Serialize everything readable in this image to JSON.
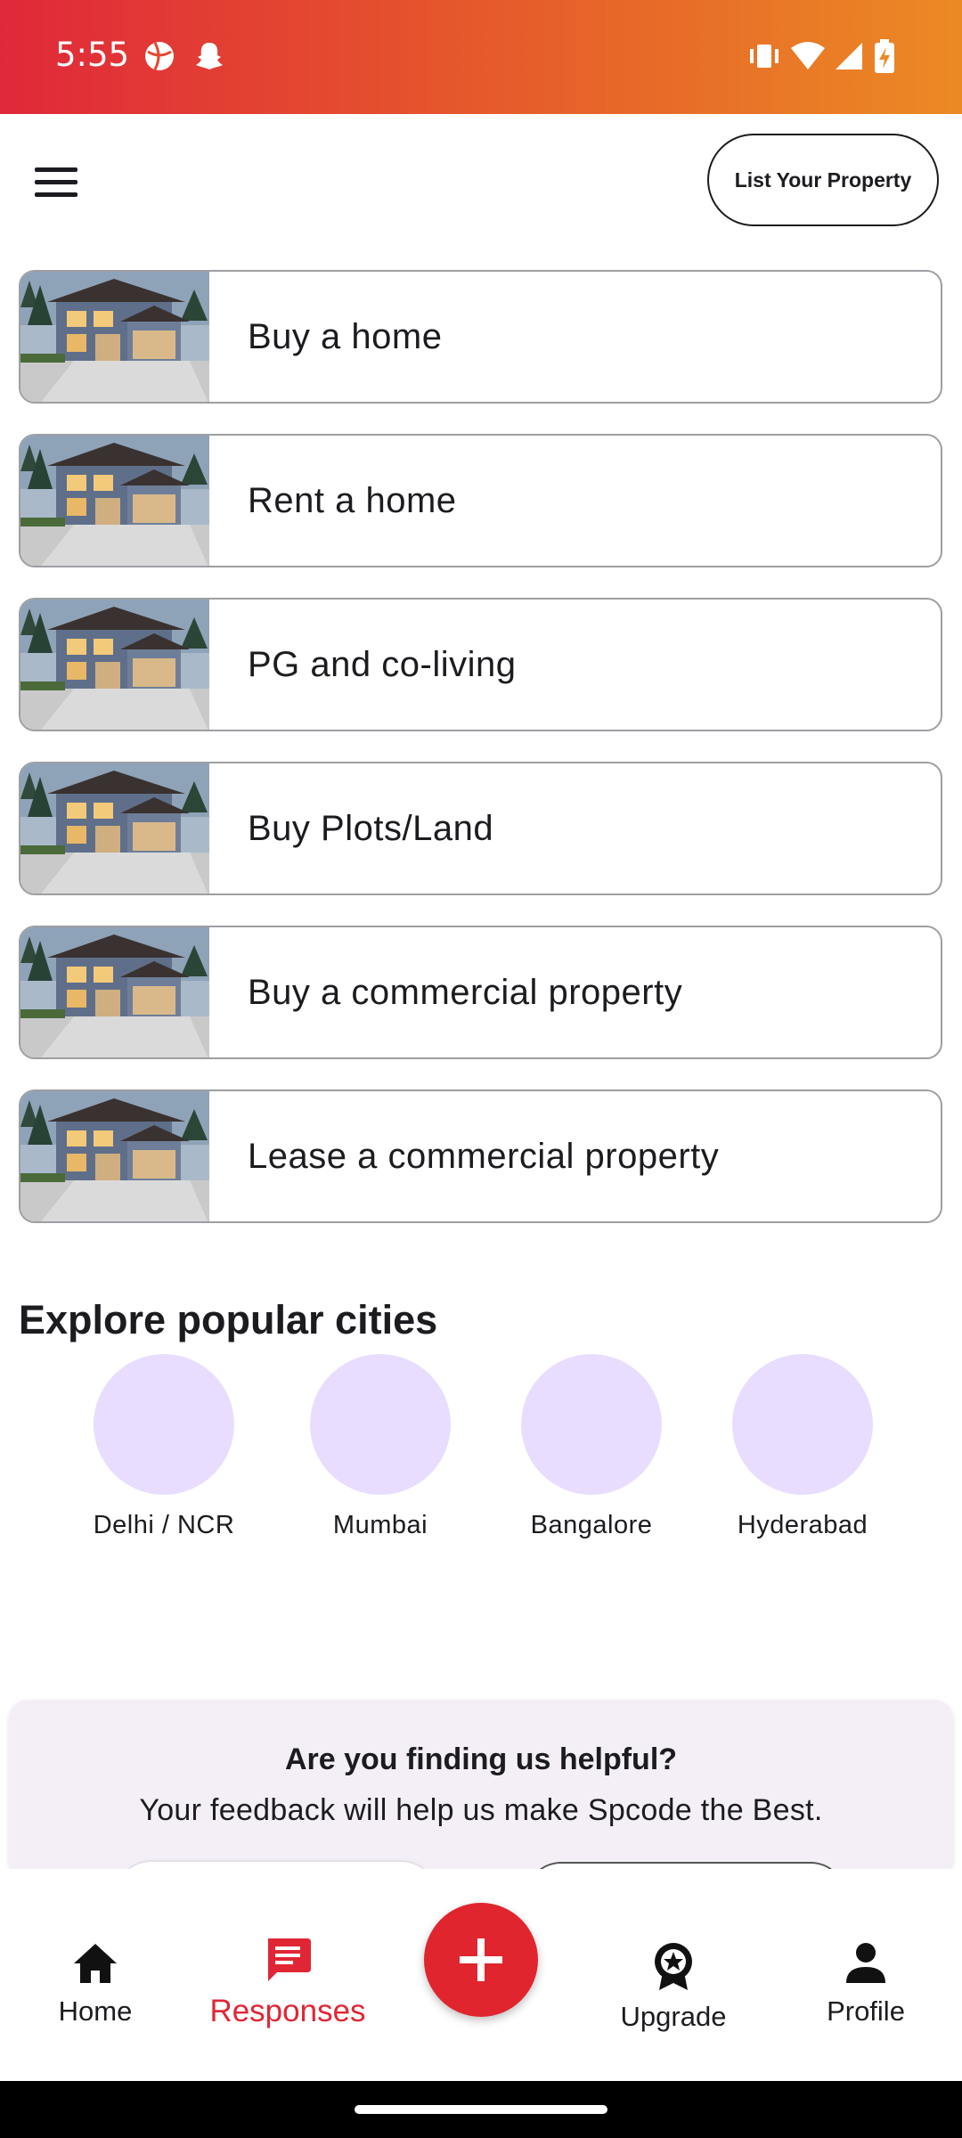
{
  "status_bar": {
    "time": "5:55",
    "icons": [
      "basketball-icon",
      "snapchat-icon",
      "vibrate-icon",
      "wifi-icon",
      "signal-icon",
      "battery-charging-icon"
    ]
  },
  "header": {
    "menu_icon": "hamburger-menu-icon",
    "list_property_label": "List Your Property"
  },
  "categories": [
    {
      "label": "Buy a home"
    },
    {
      "label": "Rent a home"
    },
    {
      "label": "PG and co-living"
    },
    {
      "label": "Buy Plots/Land"
    },
    {
      "label": "Buy a commercial property"
    },
    {
      "label": "Lease a commercial property"
    }
  ],
  "cities_section": {
    "title": "Explore popular cities",
    "cities": [
      "Delhi / NCR",
      "Mumbai",
      "Bangalore",
      "Hyderabad"
    ]
  },
  "feedback": {
    "title": "Are you finding us helpful?",
    "subtitle": "Your feedback will help us make Spcode the Best."
  },
  "bottom_nav": {
    "items": [
      {
        "label": "Home",
        "icon": "home-icon"
      },
      {
        "label": "Responses",
        "icon": "chat-icon"
      },
      {
        "label": "Upgrade",
        "icon": "badge-star-icon"
      },
      {
        "label": "Profile",
        "icon": "person-icon"
      }
    ],
    "active": "Responses",
    "fab_icon": "plus-icon"
  },
  "colors": {
    "accent": "#e0252e",
    "status_gradient_start": "#e0283a",
    "status_gradient_end": "#eb8a24",
    "city_circle": "#e9ddff",
    "feedback_bg": "#f4eff7"
  }
}
